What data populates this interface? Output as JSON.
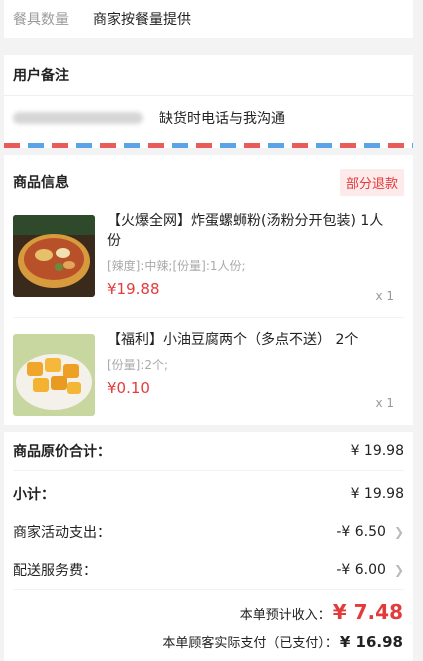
{
  "tableware": {
    "label": "餐具数量",
    "value": "商家按餐量提供"
  },
  "remark": {
    "title": "用户备注",
    "text": "缺货时电话与我沟通"
  },
  "goods": {
    "title": "商品信息",
    "badge": "部分退款",
    "items": [
      {
        "name": "【火爆全网】炸蛋螺蛳粉(汤粉分开包装) 1人份",
        "spec": "[辣度]:中辣;[份量]:1人份;",
        "price": "¥19.88",
        "qty": "x 1",
        "image": "bowl-noodles"
      },
      {
        "name": "【福利】小油豆腐两个（多点不送） 2个",
        "spec": "[份量]:2个;",
        "price": "¥0.10",
        "qty": "x 1",
        "image": "fried-tofu"
      }
    ]
  },
  "summary": {
    "original_total_label": "商品原价合计：",
    "original_total_value": "¥ 19.98",
    "subtotal_label": "小计：",
    "subtotal_value": "¥ 19.98",
    "promo_label": "商家活动支出：",
    "promo_value": "-¥ 6.50",
    "delivery_label": "配送服务费：",
    "delivery_value": "-¥ 6.00",
    "income_label": "本单预计收入：",
    "income_value": "¥ 7.48",
    "paid_label": "本单顾客实际支付（已支付）：",
    "paid_value": "¥ 16.98"
  },
  "colors": {
    "accent": "#e33b3b",
    "background": "#f3f3f3"
  }
}
